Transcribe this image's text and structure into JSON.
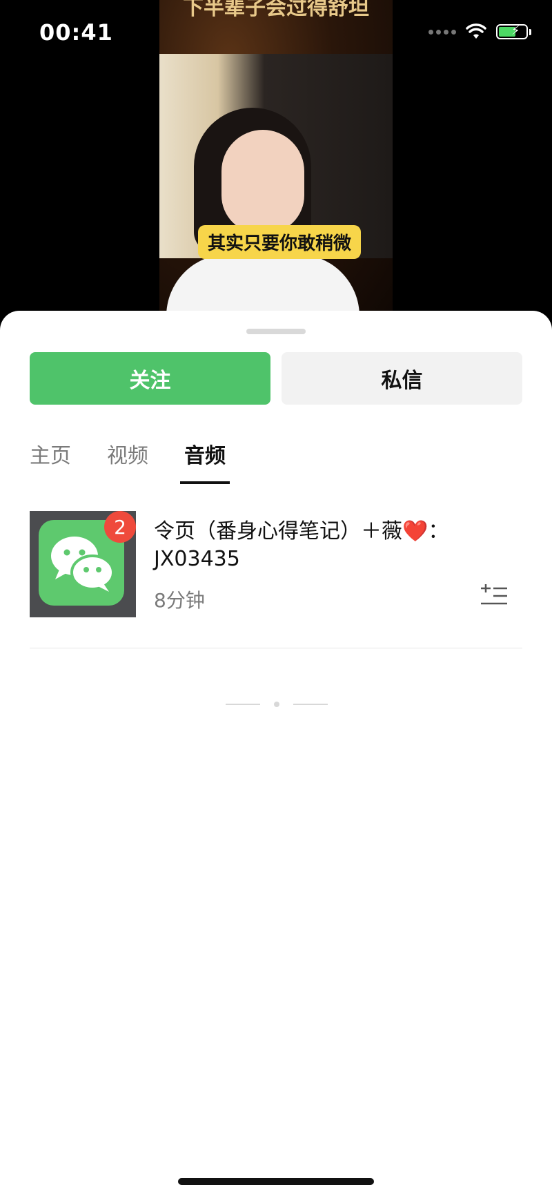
{
  "status_bar": {
    "time": "00:41"
  },
  "video": {
    "top_caption": "下半辈子会过得舒坦",
    "subtitle": "其实只要你敢稍微"
  },
  "actions": {
    "follow_label": "关注",
    "message_label": "私信"
  },
  "tabs": [
    {
      "label": "主页",
      "active": false
    },
    {
      "label": "视频",
      "active": false
    },
    {
      "label": "音频",
      "active": true
    }
  ],
  "audio_items": [
    {
      "title": "令页（番身心得笔记）＋薇❤️：JX03435",
      "duration": "8分钟",
      "badge": "2",
      "icon": "wechat-app-icon"
    }
  ],
  "icons": {
    "wifi": "wifi-icon",
    "battery": "battery-charging-icon",
    "add_to_playlist": "add-to-playlist-icon"
  },
  "colors": {
    "accent_green": "#4fc36a",
    "badge_red": "#ef4a3c"
  }
}
